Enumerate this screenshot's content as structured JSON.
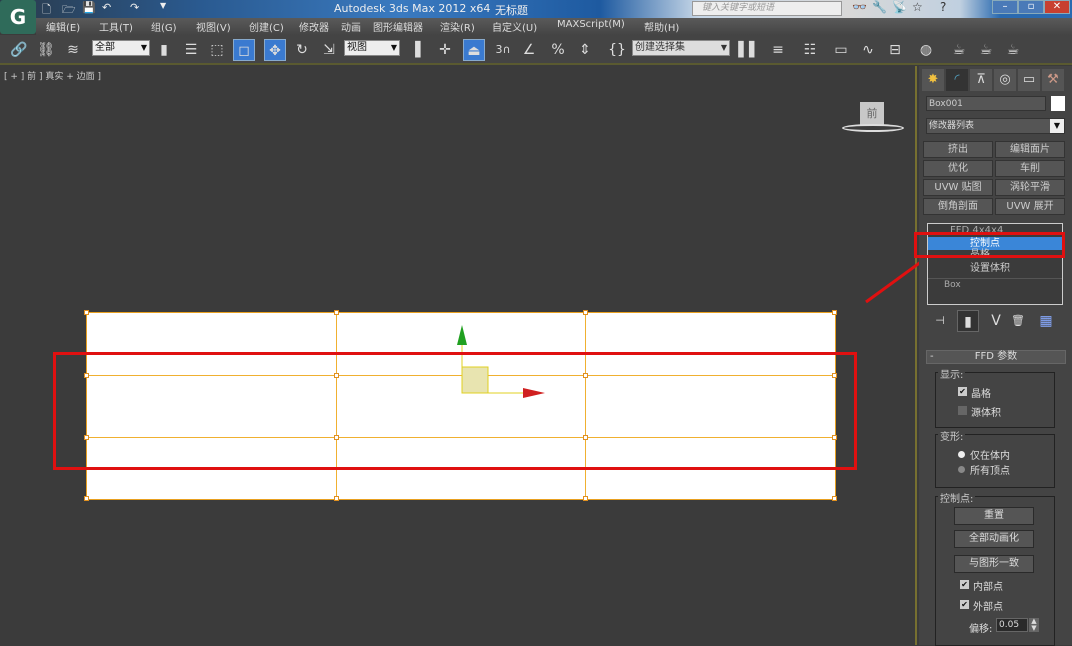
{
  "titlebar": {
    "app_title": "Autodesk 3ds Max  2012 x64",
    "document_title": "无标题",
    "search_placeholder": "键入关键字或短语"
  },
  "menubar": {
    "items": [
      "编辑(E)",
      "工具(T)",
      "组(G)",
      "视图(V)",
      "创建(C)",
      "修改器",
      "动画",
      "图形编辑器",
      "渲染(R)",
      "自定义(U)",
      "MAXScript(M)",
      "帮助(H)"
    ]
  },
  "toolbar": {
    "selection_filter": "全部",
    "ref_coord": "视图",
    "snap_3": "3",
    "named_selection_placeholder": "创建选择集"
  },
  "viewport": {
    "label": "[ + ] 前 ] 真实 + 边面 ]",
    "viewcube_face": "前"
  },
  "panel": {
    "object_name": "Box001",
    "modifier_list": "修改器列表",
    "modifier_buttons": [
      "挤出",
      "编辑面片",
      "优化",
      "车削",
      "UVW 贴图",
      "涡轮平滑",
      "倒角剖面",
      "UVW 展开"
    ],
    "stack": {
      "modifier": "FFD 4x4x4",
      "sub_items": [
        "控制点",
        "晶格",
        "设置体积"
      ],
      "base": "Box"
    },
    "rollout_title": "FFD 参数",
    "display": {
      "label": "显示:",
      "lattice": "晶格",
      "lattice_checked": true,
      "source_volume": "源体积",
      "source_volume_checked": false
    },
    "deform": {
      "label": "变形:",
      "only_in_volume": "仅在体内",
      "all_vertices": "所有顶点",
      "selected": "仅在体内"
    },
    "control_points": {
      "label": "控制点:",
      "reset": "重置",
      "animate_all": "全部动画化",
      "conform_to_shape": "与图形一致",
      "inside_points": "内部点",
      "inside_checked": true,
      "outside_points": "外部点",
      "outside_checked": true,
      "offset_label": "偏移:",
      "offset_value": "0.05"
    }
  },
  "colors": {
    "highlight": "#e01010",
    "selection": "#3a86d8",
    "lattice": "#f0b030"
  }
}
